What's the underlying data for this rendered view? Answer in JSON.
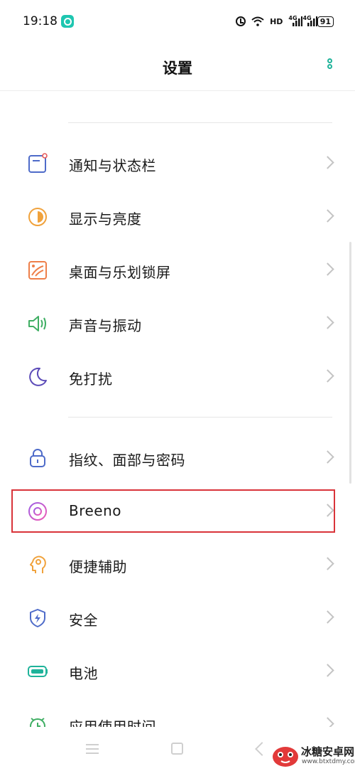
{
  "status_bar": {
    "time": "19:18",
    "hd_label": "HD",
    "net1": "4G",
    "net2": "4G",
    "battery": "91"
  },
  "header": {
    "title": "设置"
  },
  "settings": [
    {
      "label": "通知与状态栏",
      "icon": "notification-icon"
    },
    {
      "label": "显示与亮度",
      "icon": "display-icon"
    },
    {
      "label": "桌面与乐划锁屏",
      "icon": "wallpaper-icon"
    },
    {
      "label": "声音与振动",
      "icon": "sound-icon"
    },
    {
      "label": "免打扰",
      "icon": "moon-icon"
    },
    {
      "label": "指纹、面部与密码",
      "icon": "lock-icon"
    },
    {
      "label": "Breeno",
      "icon": "breeno-icon"
    },
    {
      "label": "便捷辅助",
      "icon": "assist-icon"
    },
    {
      "label": "安全",
      "icon": "shield-icon"
    },
    {
      "label": "电池",
      "icon": "battery-icon"
    },
    {
      "label": "应用使用时间",
      "icon": "app-time-icon"
    }
  ],
  "watermark": {
    "name": "冰糖安卓网",
    "url": "www.btxtdmy.com"
  },
  "colors": {
    "accent": "#1fb39a",
    "highlight_border": "#d9343a"
  }
}
